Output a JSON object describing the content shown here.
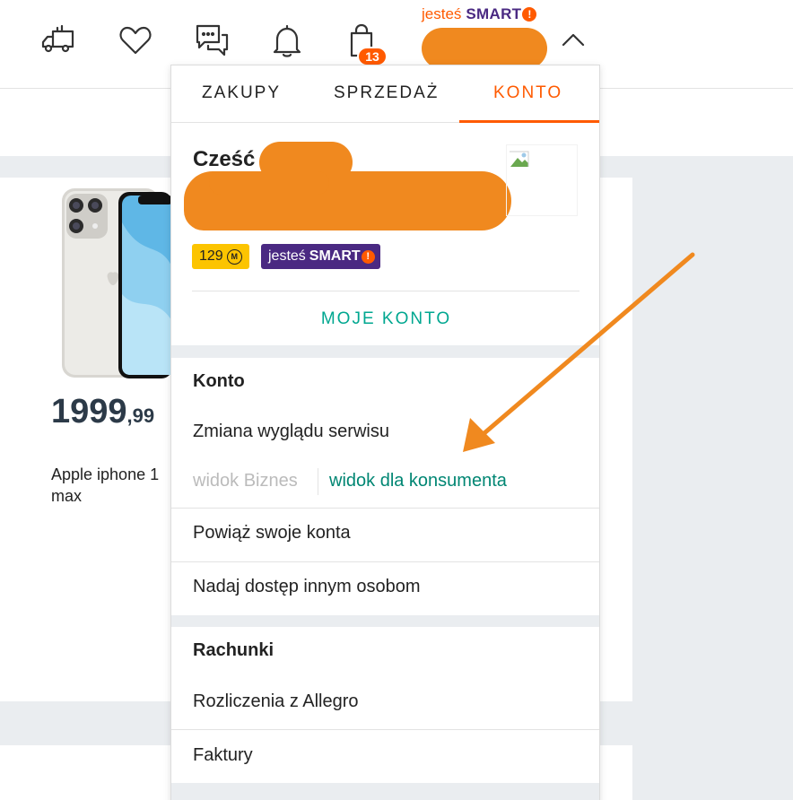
{
  "header": {
    "cart_count": "13",
    "smart_promo": {
      "prefix": "jesteś",
      "brand": "SMART",
      "mark": "!"
    }
  },
  "product": {
    "price_int": "1999",
    "price_dec": ",99",
    "title": "Apple iphone 1\nmax"
  },
  "menu": {
    "tabs": [
      {
        "label": "ZAKUPY"
      },
      {
        "label": "SPRZEDAŻ"
      },
      {
        "label": "KONTO"
      }
    ],
    "greeting": "Cześć",
    "coins": "129",
    "coin_symbol": "M",
    "smart_badge": {
      "prefix": "jesteś",
      "brand": "SMART",
      "mark": "!"
    },
    "my_account": "MOJE KONTO",
    "section_account": "Konto",
    "change_view": "Zmiana wyglądu serwisu",
    "view_business": "widok Biznes",
    "view_consumer": "widok dla konsumenta",
    "link_accounts": "Powiąż swoje konta",
    "grant_access": "Nadaj dostęp innym osobom",
    "section_bills": "Rachunki",
    "settlements": "Rozliczenia z Allegro",
    "invoices": "Faktury"
  },
  "colors": {
    "accent": "#ff5a00",
    "teal": "#00a790",
    "smart_purple": "#4a2982",
    "annotation": "#f0891f"
  }
}
